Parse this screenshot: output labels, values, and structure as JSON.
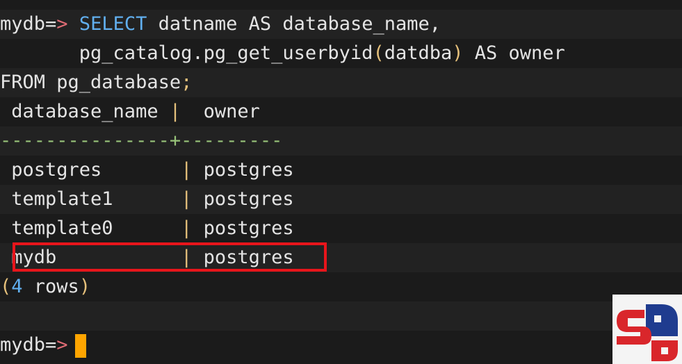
{
  "terminal": {
    "prompt": "mydb=",
    "prompt_arrow": ">",
    "query": {
      "line1_kw": "SELECT",
      "line1_rest": " datname AS database_name,",
      "line2_pre": "       pg_catalog.pg_get_userbyid",
      "line2_open": "(",
      "line2_arg": "datdba",
      "line2_close": ")",
      "line2_post": " AS owner",
      "line3_text": "FROM pg_database",
      "line3_semi": ";"
    },
    "result": {
      "headers": [
        " database_name ",
        "  owner"
      ],
      "header_sep": "|",
      "divider_left": "---------------",
      "divider_cross": "+",
      "divider_right": "---------",
      "rows": [
        {
          "name": " postgres       ",
          "owner": " postgres"
        },
        {
          "name": " template1      ",
          "owner": " postgres"
        },
        {
          "name": " template0      ",
          "owner": " postgres"
        },
        {
          "name": " mydb           ",
          "owner": " postgres"
        }
      ],
      "cell_sep": "|",
      "count_open": "(",
      "count_num": "4",
      "count_word": " rows",
      "count_close": ")"
    },
    "final_prompt": "mydb=",
    "final_arrow": ">"
  },
  "colors": {
    "background": "#1b1b1b",
    "keyword": "#61afef",
    "punctuation": "#e5c07b",
    "arrow": "#e06c75",
    "cursor": "#ffa500",
    "highlight": "#e8151b"
  },
  "logo": {
    "name": "sb-logo-icon"
  }
}
